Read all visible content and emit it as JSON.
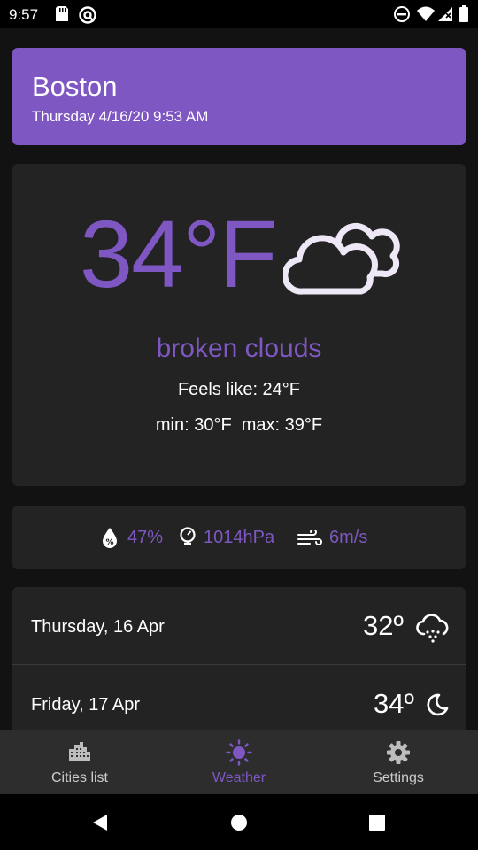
{
  "status_bar": {
    "time": "9:57",
    "left_icons": [
      "sd-card-icon",
      "sync-icon"
    ],
    "right_icons": [
      "dnd-icon",
      "wifi-icon",
      "signal-icon",
      "battery-icon"
    ]
  },
  "city": {
    "name": "Boston",
    "datetime": "Thursday 4/16/20 9:53 AM"
  },
  "current": {
    "temperature": "34°F",
    "icon": "broken-clouds-icon",
    "description": "broken clouds",
    "feels_like": "Feels like: 24°F",
    "min_max": "min: 30°F  max: 39°F"
  },
  "details": {
    "humidity": "47%",
    "pressure": "1014hPa",
    "wind": "6m/s"
  },
  "forecast": [
    {
      "day": "Thursday, 16 Apr",
      "temp": "32º",
      "icon": "snow-cloud-icon"
    },
    {
      "day": "Friday, 17 Apr",
      "temp": "34º",
      "icon": "moon-icon"
    }
  ],
  "nav": {
    "items": [
      {
        "label": "Cities list",
        "icon": "city-icon",
        "active": false
      },
      {
        "label": "Weather",
        "icon": "sun-icon",
        "active": true
      },
      {
        "label": "Settings",
        "icon": "gear-icon",
        "active": false
      }
    ]
  },
  "colors": {
    "accent": "#7e57c2",
    "card": "#232323",
    "background": "#121212",
    "nav_inactive": "#cccccc"
  }
}
